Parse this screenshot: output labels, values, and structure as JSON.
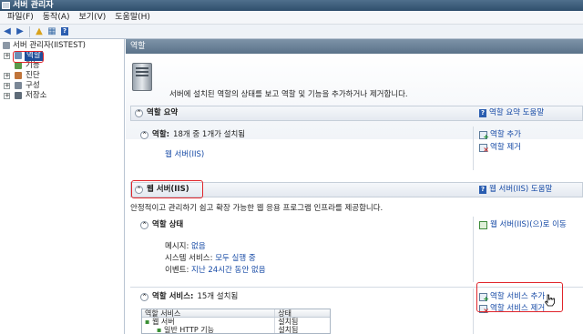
{
  "window": {
    "title": "서버 관리자"
  },
  "menu": {
    "items": [
      "파일(F)",
      "동작(A)",
      "보기(V)",
      "도움말(H)"
    ]
  },
  "toolbar": {
    "icons": [
      "back-arrow-icon",
      "forward-arrow-icon",
      "up-folder-icon",
      "grid-view-icon",
      "help-icon"
    ]
  },
  "tree": {
    "root": "서버 관리자(IISTEST)",
    "items": [
      {
        "label": "역할",
        "selected": true
      },
      {
        "label": "기능"
      },
      {
        "label": "진단"
      },
      {
        "label": "구성"
      },
      {
        "label": "저장소"
      }
    ]
  },
  "main": {
    "header": "역할",
    "description": "서버에 설치된 역할의 상태를 보고 역할 및 기능을 추가하거나 제거합니다.",
    "summary": {
      "title": "역할 요약",
      "help": "역할 요약 도움말",
      "roles_label": "역할:",
      "roles_count": "18개 중 1개가 설치됨",
      "role_link": "웹 서버(IIS)",
      "actions": [
        "역할 추가",
        "역할 제거"
      ]
    },
    "web": {
      "title": "웹 서버(IIS)",
      "help": "웹 서버(IIS) 도움말",
      "desc": "안정적이고 관리하기 쉽고 확장 가능한 웹 응용 프로그램 인프라를 제공합니다.",
      "status_title": "역할 상태",
      "goto": "웹 서버(IIS)(으)로 이동",
      "messages_label": "메시지:",
      "messages_value": "없음",
      "services_label": "시스템 서비스:",
      "services_value": "모두 실행 중",
      "events_label": "이벤트:",
      "events_value": "지난 24시간 동안 없음",
      "rs_title": "역할 서비스:",
      "rs_count": "15개 설치됨",
      "rs_actions": [
        "역할 서비스 추가",
        "역할 서비스 제거"
      ],
      "table": {
        "headers": [
          "역할 서비스",
          "상태"
        ],
        "rows": [
          {
            "name": "웹 서버",
            "status": "설치됨"
          },
          {
            "name": "일반 HTTP 기능",
            "status": "설치됨"
          }
        ]
      }
    }
  }
}
